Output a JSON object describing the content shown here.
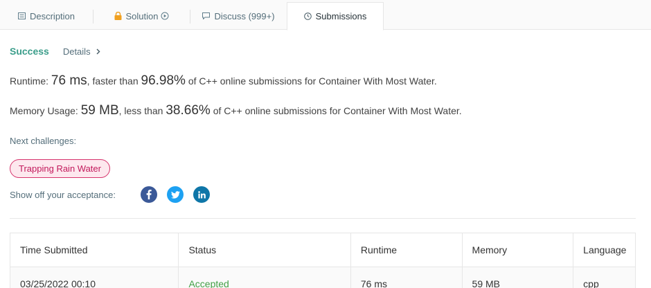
{
  "tabs": [
    {
      "label": "Description",
      "icon": "description-icon"
    },
    {
      "label": "Solution",
      "icon": "lock-icon"
    },
    {
      "label": "Discuss (999+)",
      "icon": "discuss-icon"
    },
    {
      "label": "Submissions",
      "icon": "clock-icon"
    }
  ],
  "result": {
    "status": "Success",
    "details_label": "Details"
  },
  "runtime": {
    "label": "Runtime:",
    "value": "76 ms",
    "compare_text": ", faster than",
    "percent": "96.98%",
    "suffix": "of C++ online submissions for Container With Most Water."
  },
  "memory": {
    "label": "Memory Usage:",
    "value": "59 MB",
    "compare_text": ", less than",
    "percent": "38.66%",
    "suffix": "of C++ online submissions for Container With Most Water."
  },
  "next_challenges": {
    "label": "Next challenges:",
    "items": [
      "Trapping Rain Water"
    ]
  },
  "share": {
    "label": "Show off your acceptance:",
    "icons": [
      "facebook-icon",
      "twitter-icon",
      "linkedin-icon"
    ]
  },
  "table": {
    "headers": [
      "Time Submitted",
      "Status",
      "Runtime",
      "Memory",
      "Language"
    ],
    "rows": [
      [
        "03/25/2022 00:10",
        "Accepted",
        "76 ms",
        "59 MB",
        "cpp"
      ]
    ]
  },
  "colors": {
    "success": "#3a9d8a",
    "accepted": "#43a047",
    "chip_border": "#d6336c",
    "chip_bg": "#fde8ee",
    "facebook": "#3b5998",
    "twitter": "#1da1f2",
    "linkedin": "#0e76a8"
  }
}
